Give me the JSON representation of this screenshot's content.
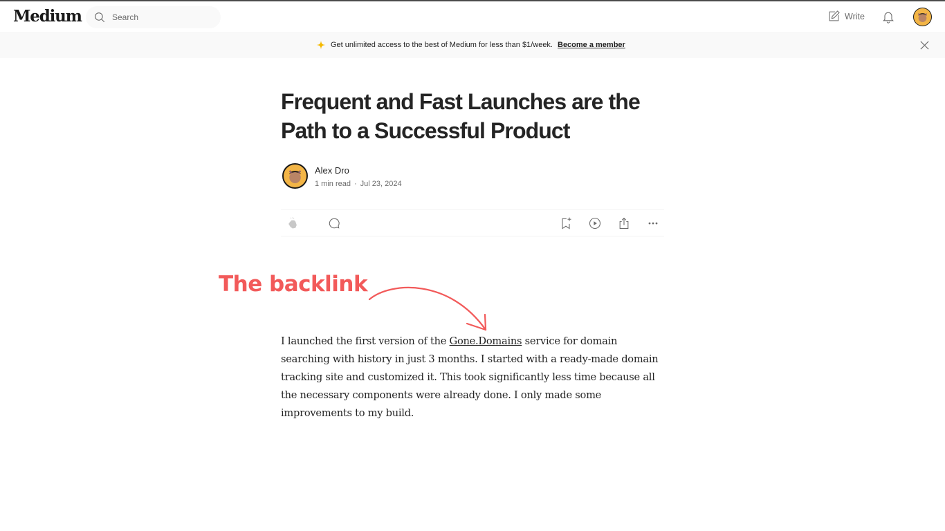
{
  "header": {
    "logo": "Medium",
    "search_placeholder": "Search",
    "write_label": "Write",
    "icons": {
      "search": "search-icon",
      "write": "edit-icon",
      "notifications": "bell-icon",
      "profile": "avatar"
    }
  },
  "banner": {
    "text": "Get unlimited access to the best of Medium for less than $1/week.",
    "link_label": "Become a member",
    "icon": "sparkle-icon",
    "icon_color": "#f5b900",
    "close_icon": "close-icon"
  },
  "article": {
    "title": "Frequent and Fast Launches are the Path to a Successful Product",
    "author": "Alex Dro",
    "read_time": "1 min read",
    "separator": "·",
    "date": "Jul 23, 2024",
    "actions": [
      "clap-icon",
      "comment-icon",
      "bookmark-add-icon",
      "play-icon",
      "share-icon",
      "more-icon"
    ],
    "body": {
      "before_link": "I launched the first version of the ",
      "link_text": "Gone.Domains",
      "after_link": " service for domain searching with history in just 3 months. I started with a ready-made domain tracking site and customized it. This took significantly less time because all the necessary components were already done. I only made some improvements to my build."
    }
  },
  "annotation": {
    "label": "The backlink",
    "color": "#f25a5a"
  }
}
